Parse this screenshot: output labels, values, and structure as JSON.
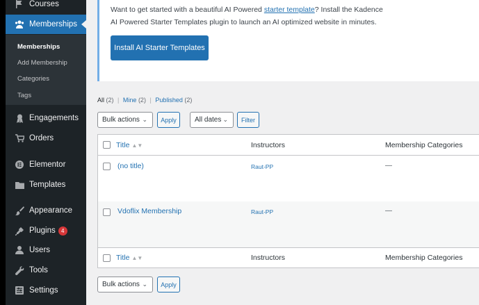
{
  "sidebar": {
    "courses": "Courses",
    "memberships": "Memberships",
    "submenu": [
      "Memberships",
      "Add Membership",
      "Categories",
      "Tags"
    ],
    "engagements": "Engagements",
    "orders": "Orders",
    "elementor": "Elementor",
    "templates": "Templates",
    "appearance": "Appearance",
    "plugins": "Plugins",
    "plugins_badge": "4",
    "users": "Users",
    "tools": "Tools",
    "settings": "Settings"
  },
  "notice": {
    "text_before": "Want to get started with a beautiful AI Powered ",
    "link": "starter template",
    "text_after": "? Install the Kadence AI Powered Starter Templates plugin to launch an AI optimized website in minutes.",
    "button": "Install AI Starter Templates"
  },
  "views": {
    "all": "All",
    "all_count": "(2)",
    "mine": "Mine",
    "mine_count": "(2)",
    "published": "Published",
    "published_count": "(2)",
    "sep": "|"
  },
  "filters": {
    "bulk_actions": "Bulk actions",
    "apply": "Apply",
    "all_dates": "All dates",
    "filter": "Filter"
  },
  "table": {
    "col_title": "Title",
    "col_instructors": "Instructors",
    "col_categories": "Membership Categories",
    "rows": [
      {
        "title": "(no title)",
        "instructor": "Raut-PP",
        "categories": "—"
      },
      {
        "title": "Vdoflix Membership",
        "instructor": "Raut-PP",
        "categories": "—"
      }
    ]
  },
  "colors": {
    "sidebar_bg": "#1d2327",
    "accent": "#2271b1",
    "badge": "#d63638"
  }
}
